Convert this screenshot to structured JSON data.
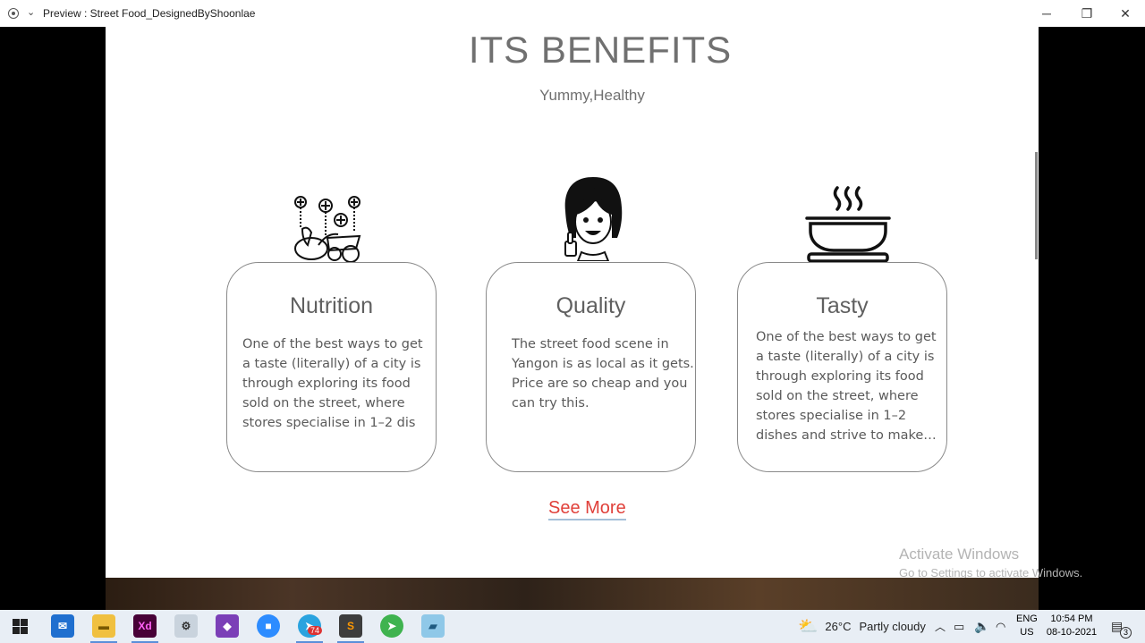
{
  "window": {
    "title": "Preview : Street Food_DesignedByShoonlae",
    "minimize": "─",
    "restore": "❐",
    "close": "✕"
  },
  "section": {
    "heading": "ITS BENEFITS",
    "subheading": "Yummy,Healthy"
  },
  "cards": [
    {
      "title": "Nutrition",
      "icon": "groceries-icon",
      "lines": [
        "One of the best ways to get",
        "a taste (literally) of a city is",
        "through exploring its food",
        "sold on the street, where",
        "stores specialise in 1–2 dis"
      ]
    },
    {
      "title": "Quality",
      "icon": "girl-thumbs-up-icon",
      "lines": [
        "The street food scene in",
        "Yangon is as local as it gets.",
        "Price are so cheap and you",
        "can try this."
      ]
    },
    {
      "title": "Tasty",
      "icon": "hot-bowl-icon",
      "lines": [
        "One of the best ways to get",
        "a taste (literally) of a city is",
        "through exploring its food",
        "sold on the street, where",
        "stores specialise in 1–2",
        "dishes and strive to make…"
      ]
    }
  ],
  "see_more": "See More",
  "watermark": {
    "line1": "Activate Windows",
    "line2": "Go to Settings to activate Windows."
  },
  "taskbar": {
    "apps": [
      "windows-start",
      "mail",
      "file-explorer",
      "adobe-xd",
      "network-tool",
      "visual-studio",
      "zoom",
      "telegram",
      "sublime-text",
      "vpn",
      "notes"
    ],
    "xd_label": "Xd",
    "telegram_badge": "74",
    "weather_temp": "26°C",
    "weather_text": "Partly cloudy",
    "lang": "ENG",
    "region": "US",
    "time": "10:54 PM",
    "date": "08-10-2021",
    "notification_count": "3"
  },
  "colors": {
    "heading": "#707070",
    "link": "#e0403a",
    "card_border": "#8a8a8a"
  }
}
